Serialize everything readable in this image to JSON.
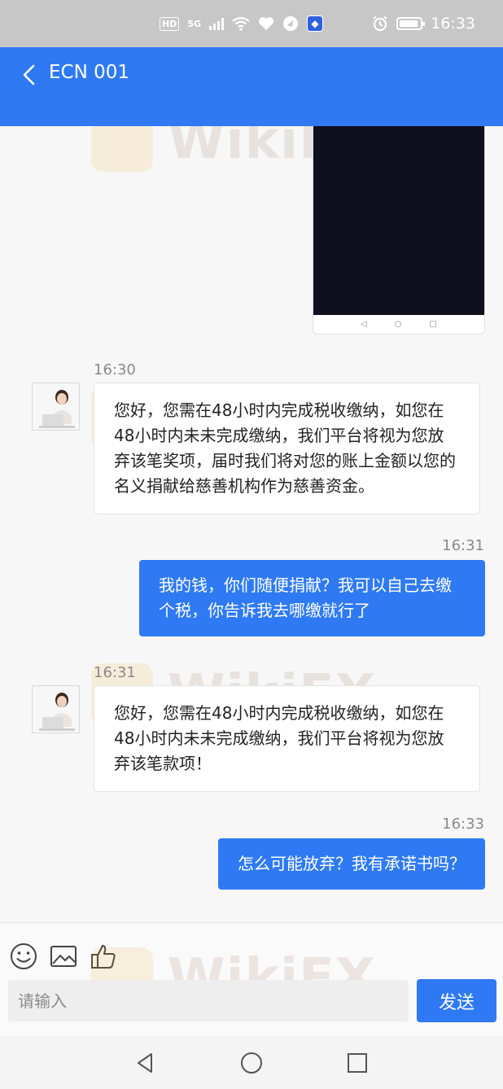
{
  "status_bar": {
    "network_badge": "HD",
    "network_type": "5G",
    "time": "16:33"
  },
  "header": {
    "title": "ECN 001"
  },
  "messages": [
    {
      "timestamp": "16:30",
      "direction": "in",
      "text": "您好，您需在48小时内完成税收缴纳，如您在48小时内未未完成缴纳，我们平台将视为您放弃该笔奖项，届时我们将对您的账上金额以您的名义捐献给慈善机构作为慈善资金。"
    },
    {
      "timestamp": "16:31",
      "direction": "out",
      "text": "我的钱，你们随便捐献？我可以自己去缴个税，你告诉我去哪缴就行了"
    },
    {
      "timestamp": "16:31",
      "direction": "in",
      "text": "您好，您需在48小时内完成税收缴纳，如您在48小时内未未完成缴纳，我们平台将视为您放弃该笔款项！"
    },
    {
      "timestamp": "16:33",
      "direction": "out",
      "text": "怎么可能放弃？我有承诺书吗？"
    }
  ],
  "input": {
    "placeholder": "请输入",
    "value": ""
  },
  "send_button": {
    "label": "发送"
  },
  "watermark": {
    "text": "WikiFX"
  },
  "colors": {
    "accent": "#2f7af4",
    "status_bar": "#c7c7c7",
    "chat_bg": "#f7f7f7"
  },
  "icons": [
    "back-icon",
    "emoji-icon",
    "image-icon",
    "thumbs-up-icon",
    "nav-back-icon",
    "nav-home-icon",
    "nav-recents-icon"
  ]
}
